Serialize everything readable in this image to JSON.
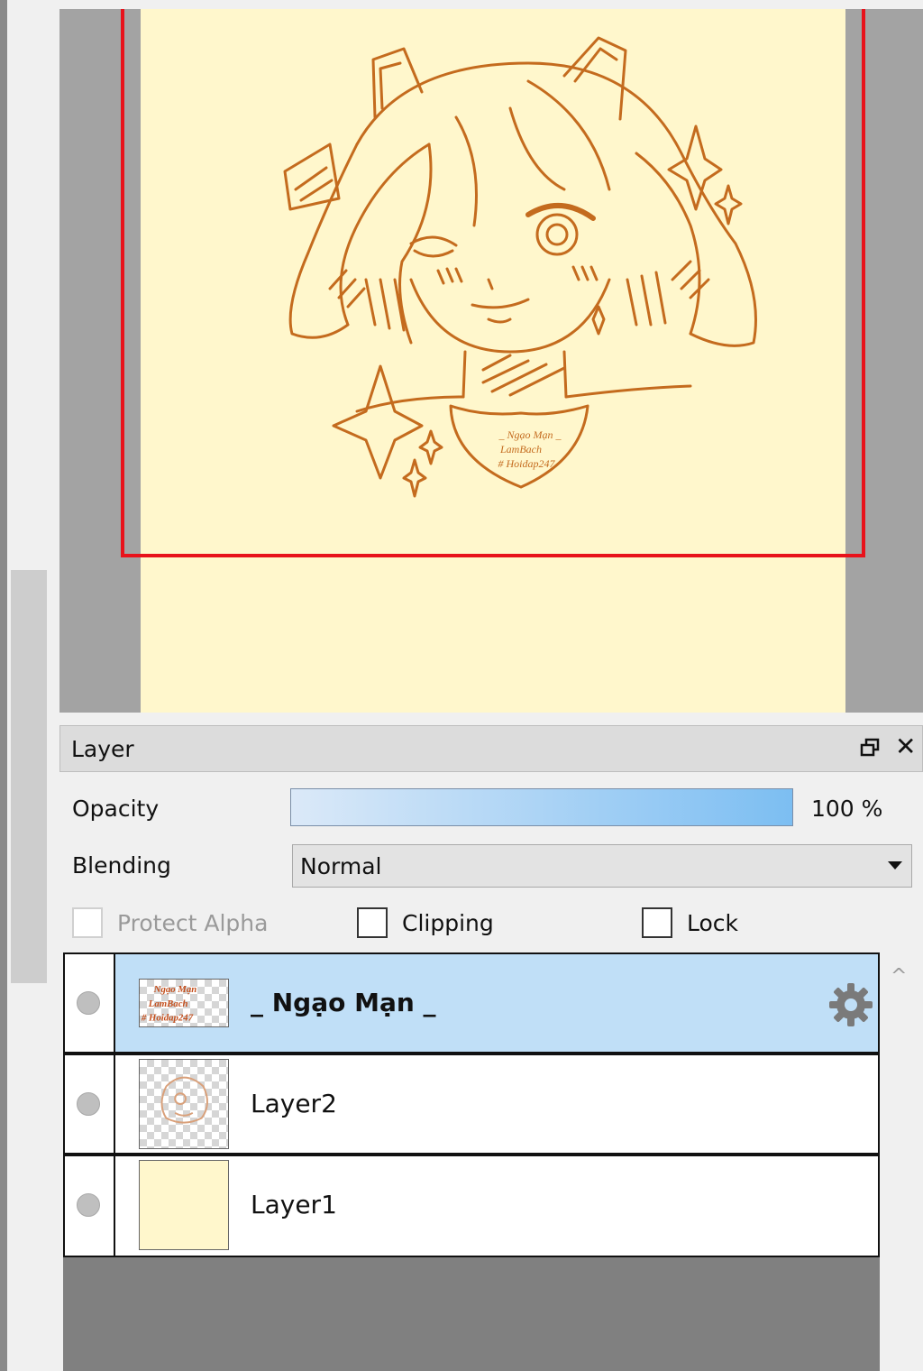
{
  "panel": {
    "title": "Layer",
    "opacity_label": "Opacity",
    "opacity_percent": 100,
    "opacity_value": "100 %",
    "blending_label": "Blending",
    "blending_value": "Normal",
    "protect_alpha_label": "Protect Alpha",
    "clipping_label": "Clipping",
    "lock_label": "Lock"
  },
  "layers": [
    {
      "name": "_ Ngạo Mạn _",
      "selected": true,
      "thumb_text": [
        "Ngạo Mạn",
        "LamBach",
        "# Hoidap247"
      ]
    },
    {
      "name": "Layer2",
      "selected": false
    },
    {
      "name": "Layer1",
      "selected": false
    }
  ],
  "artwork": {
    "signature": [
      "_ Ngạo Mạn _",
      "LamBach",
      "# Hoidap247"
    ]
  },
  "colors": {
    "paper": "#fff7cc",
    "line_art": "#c46b1e",
    "selection_frame": "#e8121b",
    "selected_row": "#c0dff7"
  }
}
